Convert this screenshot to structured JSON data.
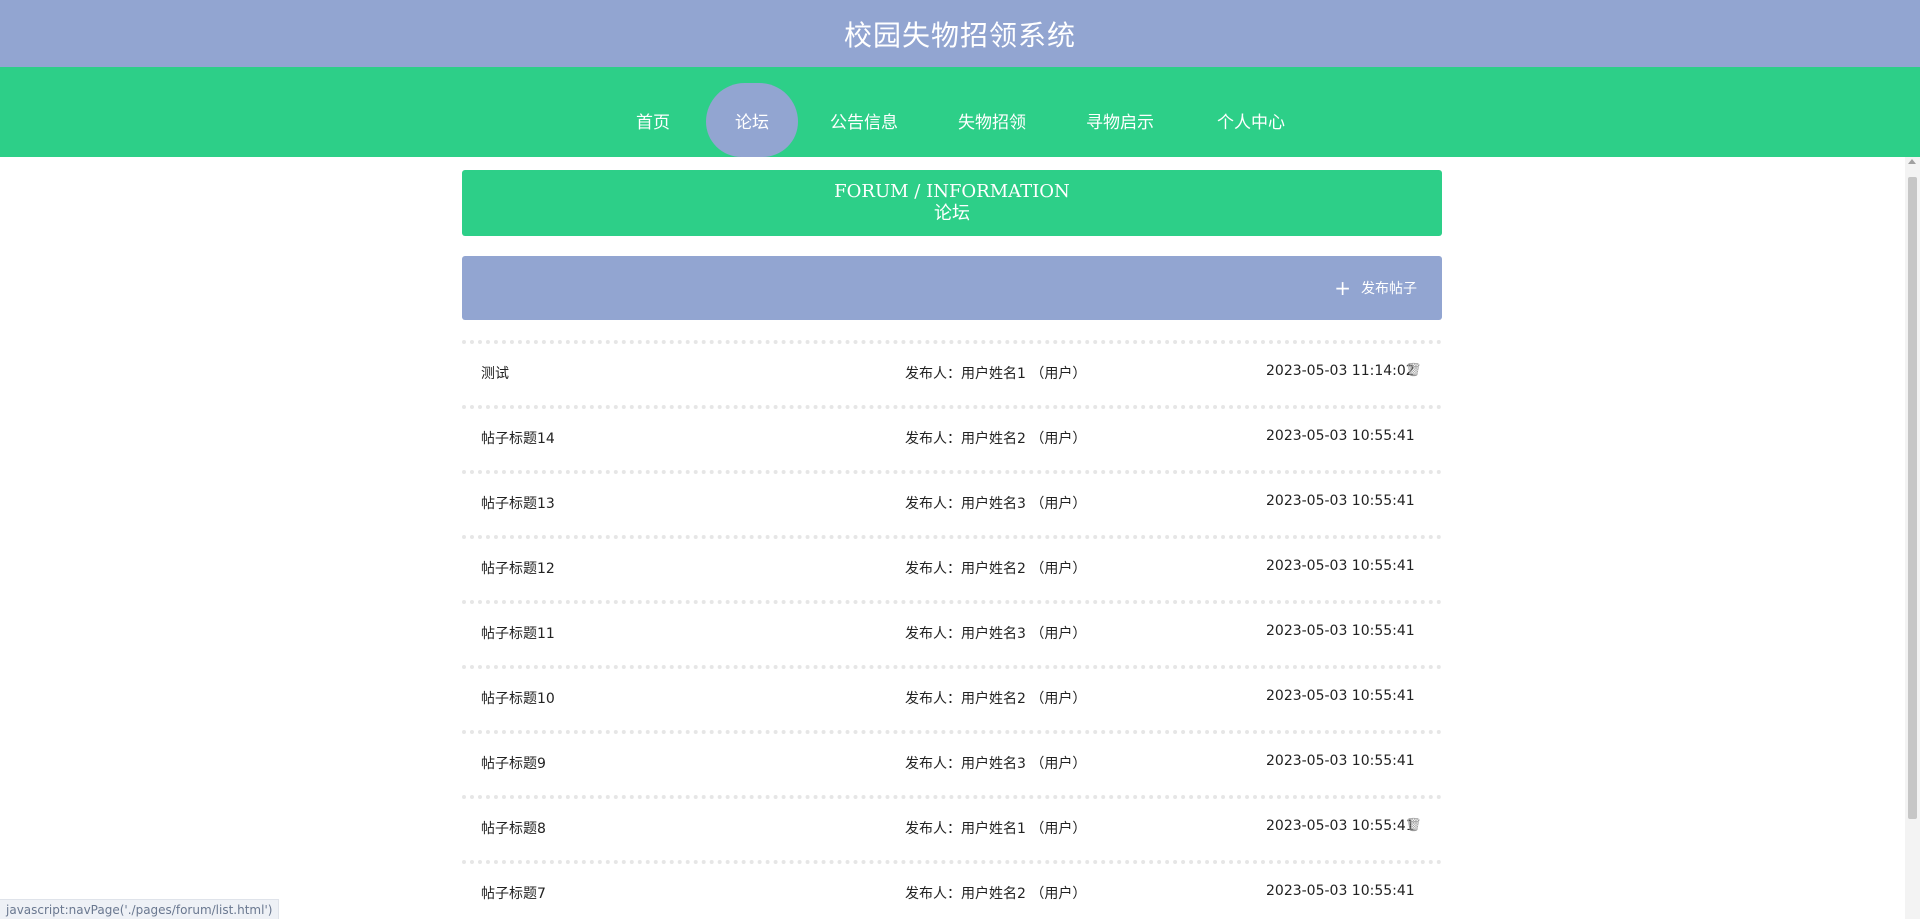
{
  "header": {
    "title": "校园失物招领系统"
  },
  "nav": {
    "items": [
      {
        "label": "首页"
      },
      {
        "label": "论坛"
      },
      {
        "label": "公告信息"
      },
      {
        "label": "失物招领"
      },
      {
        "label": "寻物启示"
      },
      {
        "label": "个人中心"
      }
    ],
    "active": "论坛"
  },
  "banner": {
    "en": "FORUM / INFORMATION",
    "cn": "论坛"
  },
  "actions": {
    "add_post_label": "发布帖子",
    "add_icon": "plus-icon"
  },
  "posts": [
    {
      "title": "测试",
      "author": "发布人：用户姓名1 （用户）",
      "time": "2023-05-03 11:14:02",
      "deletable": true
    },
    {
      "title": "帖子标题14",
      "author": "发布人：用户姓名2 （用户）",
      "time": "2023-05-03 10:55:41",
      "deletable": false
    },
    {
      "title": "帖子标题13",
      "author": "发布人：用户姓名3 （用户）",
      "time": "2023-05-03 10:55:41",
      "deletable": false
    },
    {
      "title": "帖子标题12",
      "author": "发布人：用户姓名2 （用户）",
      "time": "2023-05-03 10:55:41",
      "deletable": false
    },
    {
      "title": "帖子标题11",
      "author": "发布人：用户姓名3 （用户）",
      "time": "2023-05-03 10:55:41",
      "deletable": false
    },
    {
      "title": "帖子标题10",
      "author": "发布人：用户姓名2 （用户）",
      "time": "2023-05-03 10:55:41",
      "deletable": false
    },
    {
      "title": "帖子标题9",
      "author": "发布人：用户姓名3 （用户）",
      "time": "2023-05-03 10:55:41",
      "deletable": false
    },
    {
      "title": "帖子标题8",
      "author": "发布人：用户姓名1 （用户）",
      "time": "2023-05-03 10:55:41",
      "deletable": true
    },
    {
      "title": "帖子标题7",
      "author": "发布人：用户姓名2 （用户）",
      "time": "2023-05-03 10:55:41",
      "deletable": false
    }
  ],
  "status_bar": {
    "url": "javascript:navPage('./pages/forum/list.html')"
  },
  "colors": {
    "header": "#92a5d1",
    "nav": "#2dcf88",
    "banner": "#2dcf88",
    "action_bar": "#92a5d1"
  }
}
